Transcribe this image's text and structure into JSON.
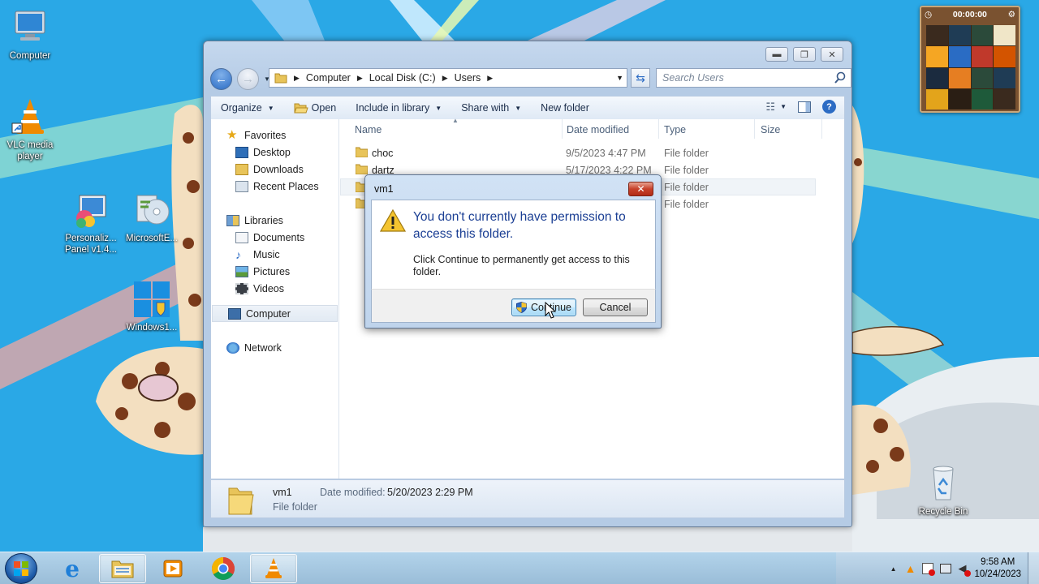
{
  "desktop": {
    "icons": [
      {
        "label": "Computer"
      },
      {
        "label": "VLC media player"
      },
      {
        "label": "Personaliz... Panel v1.4..."
      },
      {
        "label": "MicrosoftE..."
      },
      {
        "label": "Windows1..."
      },
      {
        "label": "Recycle Bin"
      }
    ]
  },
  "gadget": {
    "timer": "00:00:00"
  },
  "explorer": {
    "breadcrumb": [
      "Computer",
      "Local Disk (C:)",
      "Users"
    ],
    "search_placeholder": "Search Users",
    "toolbar": {
      "organize": "Organize",
      "open": "Open",
      "include": "Include in library",
      "share": "Share with",
      "new_folder": "New folder"
    },
    "nav": {
      "favorites": "Favorites",
      "desktop": "Desktop",
      "downloads": "Downloads",
      "recent": "Recent Places",
      "libraries": "Libraries",
      "documents": "Documents",
      "music": "Music",
      "pictures": "Pictures",
      "videos": "Videos",
      "computer": "Computer",
      "network": "Network"
    },
    "columns": {
      "name": "Name",
      "date": "Date modified",
      "type": "Type",
      "size": "Size"
    },
    "files": [
      {
        "name": "choc",
        "date": "9/5/2023 4:47 PM",
        "type": "File folder"
      },
      {
        "name": "dartz",
        "date": "5/17/2023 4:22 PM",
        "type": "File folder"
      },
      {
        "name": "",
        "date": "",
        "type": "File folder"
      },
      {
        "name": "",
        "date": "",
        "type": "File folder"
      }
    ],
    "details": {
      "name": "vm1",
      "date_label": "Date modified:",
      "date_value": "5/20/2023 2:29 PM",
      "type": "File folder"
    }
  },
  "dialog": {
    "title": "vm1",
    "close": "✕",
    "heading": "You don't currently have permission to access this folder.",
    "message": "Click Continue to permanently get access to this folder.",
    "continue": "Continue",
    "cancel": "Cancel"
  },
  "taskbar": {
    "time": "9:58 AM",
    "date": "10/24/2023"
  },
  "colors": {
    "sky": "#2aa8e6",
    "accent": "#1b3f94",
    "chrome_red": "#db4437",
    "chrome_yellow": "#f4b400",
    "chrome_green": "#0f9d58",
    "vlc_orange": "#f08a00"
  }
}
